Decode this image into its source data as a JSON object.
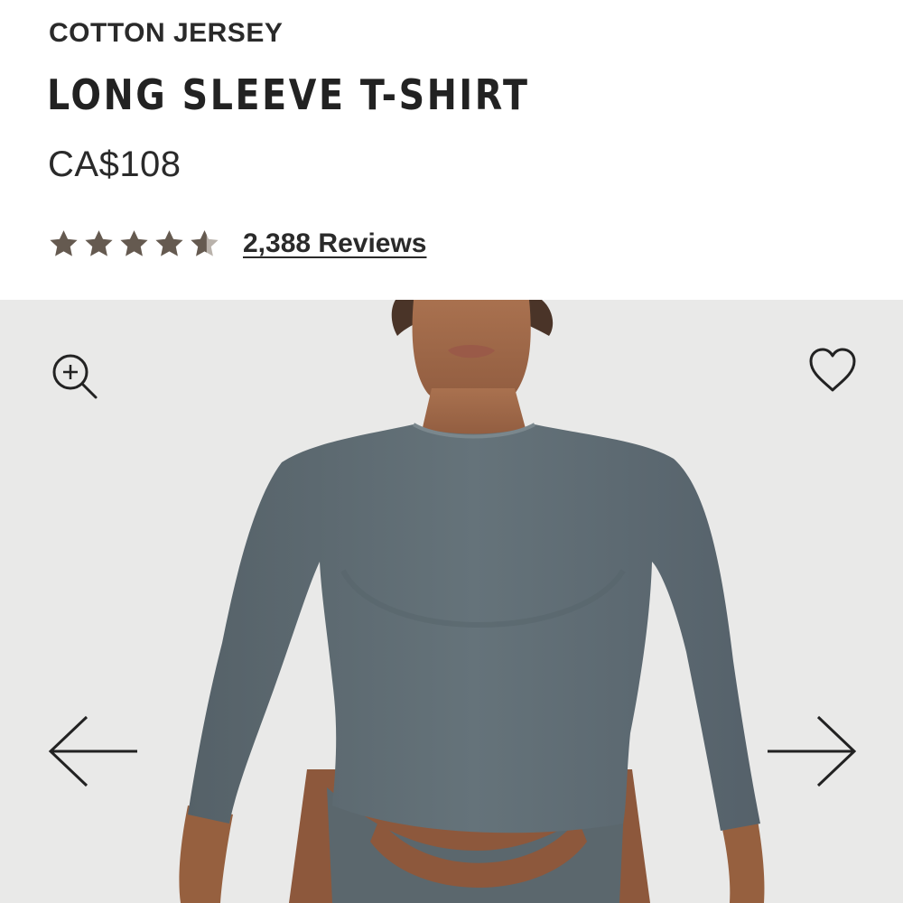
{
  "product": {
    "collection": "COTTON JERSEY",
    "name": "LONG SLEEVE T-SHIRT",
    "price": "CA$108"
  },
  "rating": {
    "stars": 4.5,
    "max_stars": 5,
    "reviews_label": "2,388 Reviews",
    "star_color": "#655a50"
  },
  "gallery": {
    "background_color": "#e9e9e8",
    "garment_color": "#5f6c72",
    "icons": {
      "zoom": "zoom-in-icon",
      "wishlist": "heart-icon",
      "prev": "arrow-left-icon",
      "next": "arrow-right-icon"
    }
  }
}
